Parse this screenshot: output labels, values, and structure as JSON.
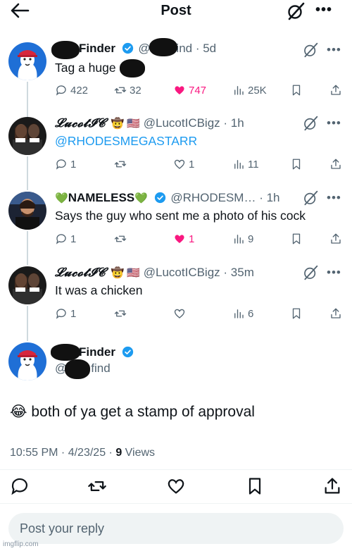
{
  "header": {
    "title": "Post",
    "back_icon": "back-arrow-icon",
    "grok_icon": "grok-icon",
    "more_icon": "more-icon"
  },
  "colors": {
    "accent": "#1d9bf0",
    "like": "#f91880",
    "muted": "#536471",
    "text": "#0f1419"
  },
  "tweets": [
    {
      "name": "Finder",
      "handle_prefix": "@",
      "handle_suffix": "find",
      "time": "· 5d",
      "text": "Tag a huge",
      "actions": {
        "replies": "422",
        "reposts": "32",
        "likes": "747",
        "views": "25K"
      },
      "liked": true
    },
    {
      "name": "𝓛𝓾𝓬𝓸𝓽𝓘𝓒",
      "emojis": "🤠 🇺🇸",
      "handle": "@LucotICBigz",
      "time": "· 1h",
      "text": "@RHODESMEGASTARR",
      "actions": {
        "replies": "1",
        "reposts": "",
        "likes": "1",
        "views": "11"
      },
      "liked": false
    },
    {
      "name_prefix": "💚",
      "name": "NAMELESS",
      "name_suffix": "💚",
      "handle": "@RHODESM…",
      "time": "· 1h",
      "text": "Says the guy who sent me a photo of his cock",
      "actions": {
        "replies": "1",
        "reposts": "",
        "likes": "1",
        "views": "9"
      },
      "liked": true
    },
    {
      "name": "𝓛𝓾𝓬𝓸𝓽𝓘𝓒",
      "emojis": "🤠 🇺🇸",
      "handle": "@LucotICBigz",
      "time": "· 35m",
      "text": "It was a chicken",
      "actions": {
        "replies": "1",
        "reposts": "",
        "likes": "",
        "views": "6"
      },
      "liked": false
    }
  ],
  "focus": {
    "name": "Finder",
    "handle_prefix": "@",
    "handle_suffix": "find",
    "emoji": "😂",
    "text": "both of ya get a stamp of approval",
    "time": "10:55 PM · 4/23/25 · ",
    "views_count": "9",
    "views_label": " Views"
  },
  "reply": {
    "placeholder": "Post your reply"
  },
  "watermark": "imgflip.com"
}
